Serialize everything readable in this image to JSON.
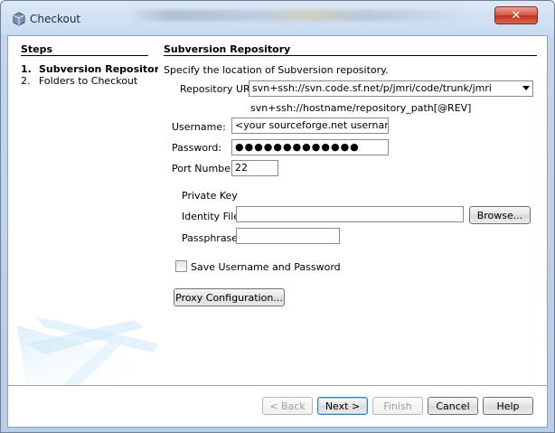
{
  "window": {
    "title": "Checkout",
    "close_glyph": "✕"
  },
  "steps": {
    "heading": "Steps",
    "items": [
      {
        "num": "1.",
        "label": "Subversion Repository"
      },
      {
        "num": "2.",
        "label": "Folders to Checkout"
      }
    ]
  },
  "panel": {
    "heading": "Subversion Repository",
    "instruction": "Specify the location of Subversion repository.",
    "repository_url": {
      "label": "Repository URL:",
      "value": "svn+ssh://svn.code.sf.net/p/jmri/code/trunk/jmri",
      "hint": "svn+ssh://hostname/repository_path[@REV]"
    },
    "username": {
      "label": "Username:",
      "value": "<your sourceforge.net username>"
    },
    "password": {
      "label": "Password:",
      "value": "●●●●●●●●●●●●●"
    },
    "port": {
      "label": "Port Number:",
      "value": "22"
    },
    "private_key": {
      "heading": "Private Key",
      "identity_label": "Identity File:",
      "identity_value": "",
      "browse_label": "Browse...",
      "passphrase_label": "Passphrase:",
      "passphrase_value": ""
    },
    "save_checkbox": {
      "label": "Save Username and Password",
      "checked": false
    },
    "proxy_button": "Proxy Configuration..."
  },
  "footer": {
    "back": "< Back",
    "next": "Next >",
    "finish": "Finish",
    "cancel": "Cancel",
    "help": "Help"
  },
  "colors": {
    "title_bar": "#c8dbef",
    "close_button": "#c0341e",
    "default_button_border": "#3c7fb1"
  }
}
